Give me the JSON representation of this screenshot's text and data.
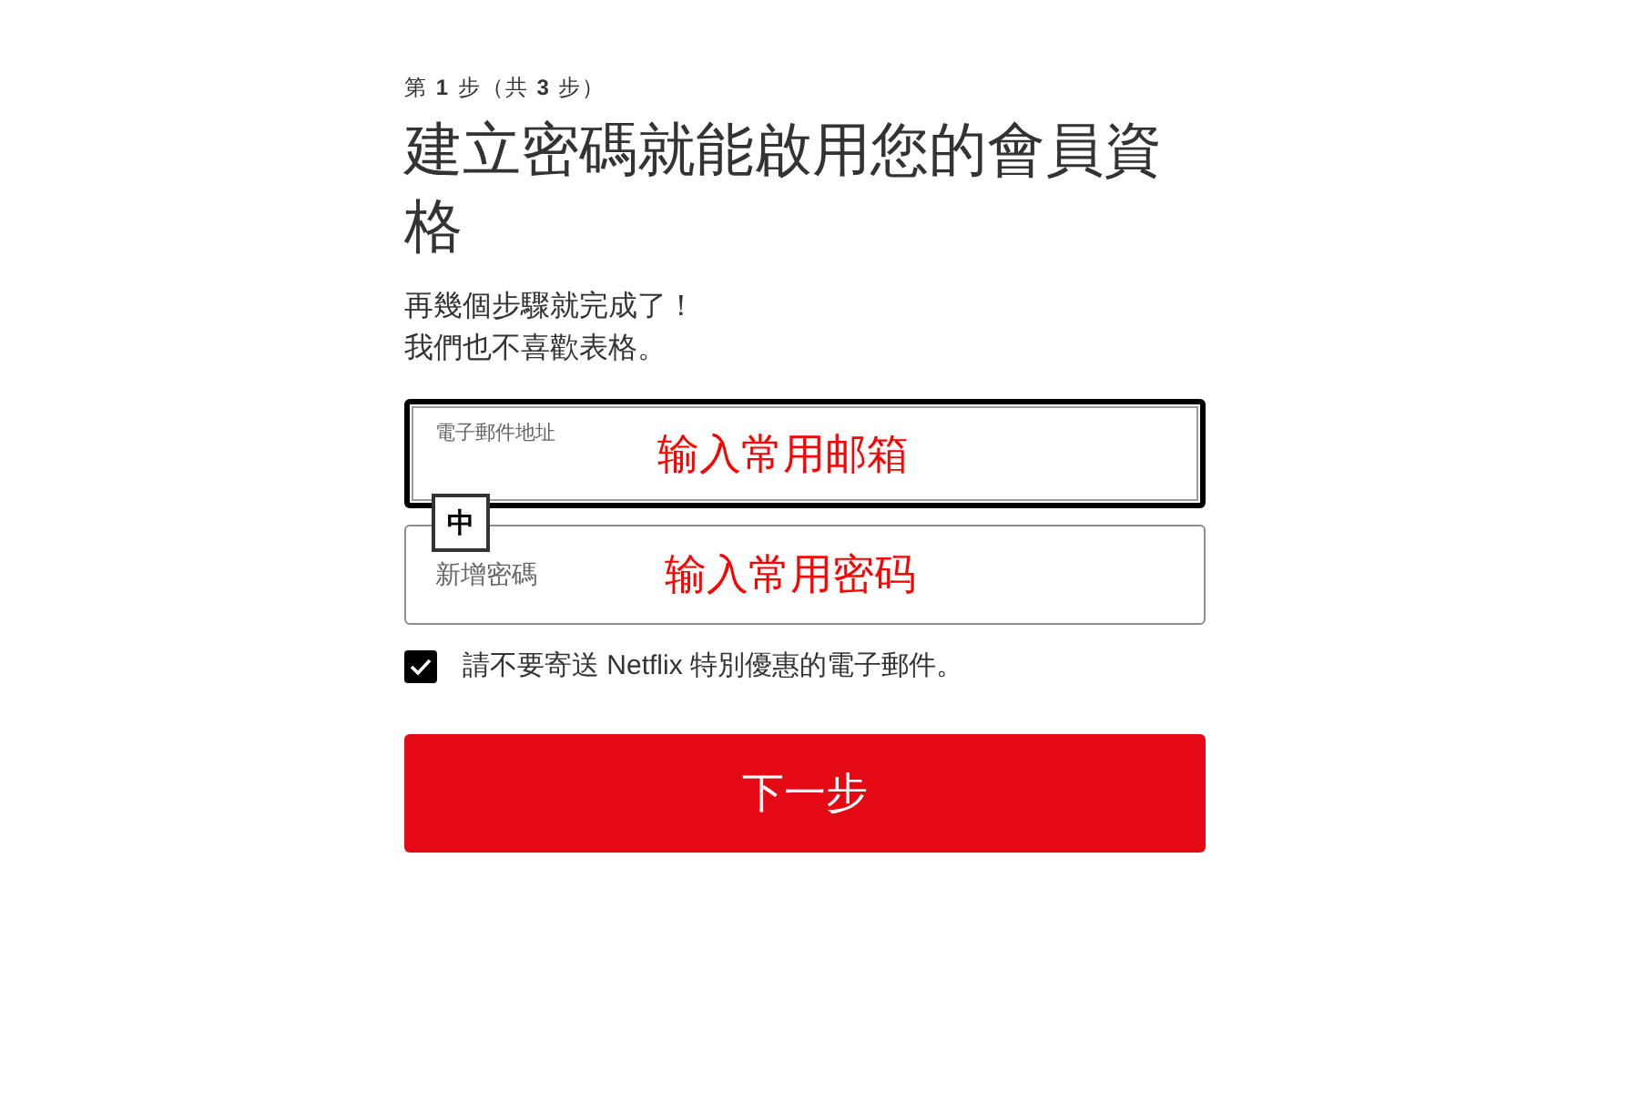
{
  "step_label": "第 **1** 步（共 **3** 步）",
  "title": "建立密碼就能啟用您的會員資格",
  "subtitle_lines": [
    "再幾個步驟就完成了！",
    "我們也不喜歡表格。"
  ],
  "fields": [
    {
      "kind": "email",
      "label": "電子郵件地址",
      "focused": true,
      "annotation": "输入常用邮箱"
    },
    {
      "kind": "password",
      "label": "新增密碼",
      "focused": false,
      "annotation": "输入常用密码"
    }
  ],
  "ime_indicator": "中",
  "opt_out": {
    "label": "請不要寄送 Netflix 特別優惠的電子郵件。",
    "checked": true
  },
  "next_button": "下一步"
}
